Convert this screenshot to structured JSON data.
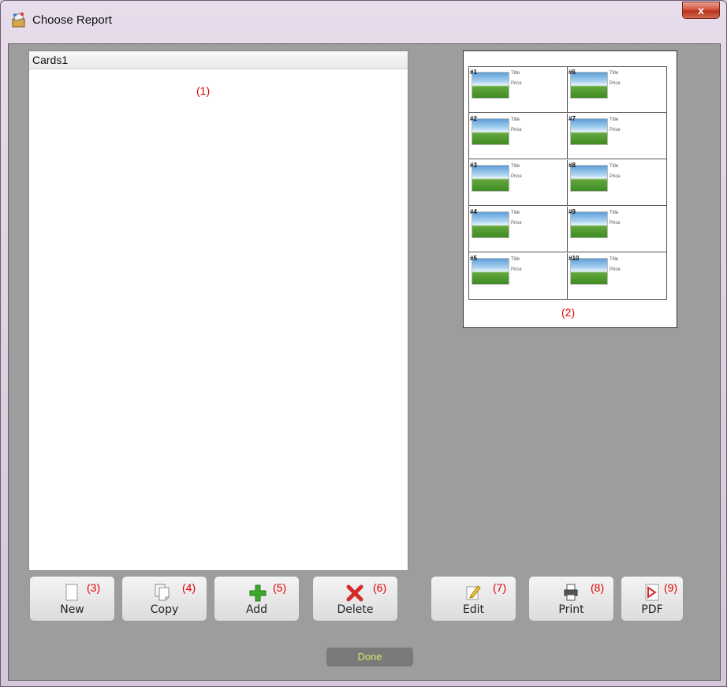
{
  "window": {
    "title": "Choose Report",
    "close_label": "x"
  },
  "list": {
    "header": "Cards1",
    "marker": "(1)"
  },
  "preview": {
    "marker": "(2)",
    "cards": [
      {
        "num": "#1",
        "title": "Title",
        "price": "Price"
      },
      {
        "num": "#6",
        "title": "Title",
        "price": "Price"
      },
      {
        "num": "#2",
        "title": "Title",
        "price": "Price"
      },
      {
        "num": "#7",
        "title": "Title",
        "price": "Price"
      },
      {
        "num": "#3",
        "title": "Title",
        "price": "Price"
      },
      {
        "num": "#8",
        "title": "Title",
        "price": "Price"
      },
      {
        "num": "#4",
        "title": "Title",
        "price": "Price"
      },
      {
        "num": "#9",
        "title": "Title",
        "price": "Price"
      },
      {
        "num": "#5",
        "title": "Title",
        "price": "Price"
      },
      {
        "num": "#10",
        "title": "Title",
        "price": "Price"
      }
    ]
  },
  "buttons": {
    "new": {
      "label": "New",
      "marker": "(3)",
      "icon": "document-icon"
    },
    "copy": {
      "label": "Copy",
      "marker": "(4)",
      "icon": "copy-icon"
    },
    "add": {
      "label": "Add",
      "marker": "(5)",
      "icon": "plus-icon"
    },
    "delete": {
      "label": "Delete",
      "marker": "(6)",
      "icon": "delete-x-icon"
    },
    "edit": {
      "label": "Edit",
      "marker": "(7)",
      "icon": "pencil-icon"
    },
    "print": {
      "label": "Print",
      "marker": "(8)",
      "icon": "printer-icon"
    },
    "pdf": {
      "label": "PDF",
      "marker": "(9)",
      "icon": "pdf-icon"
    }
  },
  "done": {
    "label": "Done"
  },
  "colors": {
    "marker": "#e20000",
    "client_bg": "#9d9d9d",
    "done_text": "#cfe86a"
  }
}
